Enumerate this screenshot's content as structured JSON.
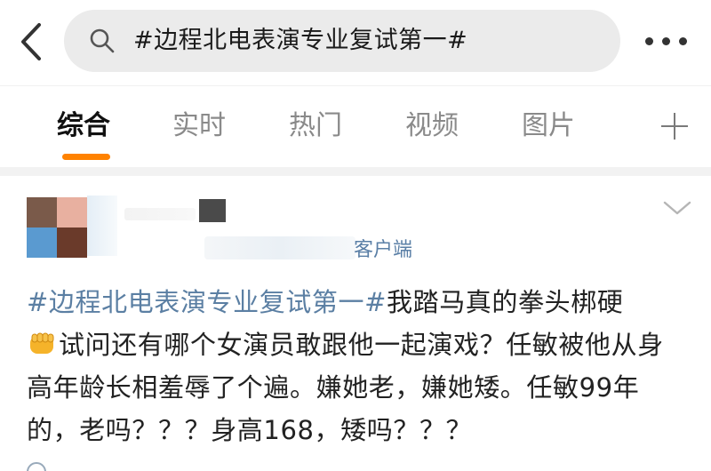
{
  "header": {
    "search_query": "#边程北电表演专业复试第一#"
  },
  "tabs": [
    {
      "label": "综合",
      "active": true
    },
    {
      "label": "实时",
      "active": false
    },
    {
      "label": "热门",
      "active": false
    },
    {
      "label": "视频",
      "active": false
    },
    {
      "label": "图片",
      "active": false
    }
  ],
  "colors": {
    "accent": "#ff8200",
    "hashtag": "#5b7fa3",
    "search_bg": "#ebebeb"
  },
  "post": {
    "source": "客户端",
    "hashtag": "#边程北电表演专业复试第一#",
    "text_part1": "我踏马真的拳头梆硬",
    "emoji_icon": "fist-emoji",
    "text_part2": "试问还有哪个女演员敢跟他一起演戏？任敏被他从身高年龄长相羞辱了个遍。嫌她老，嫌她矮。任敏99年的，老吗？？？身高168，矮吗？？？"
  },
  "icons": {
    "back": "back-arrow-icon",
    "search": "search-icon",
    "more": "more-dots-icon",
    "add_tab": "plus-icon",
    "expand": "chevron-down-icon"
  }
}
